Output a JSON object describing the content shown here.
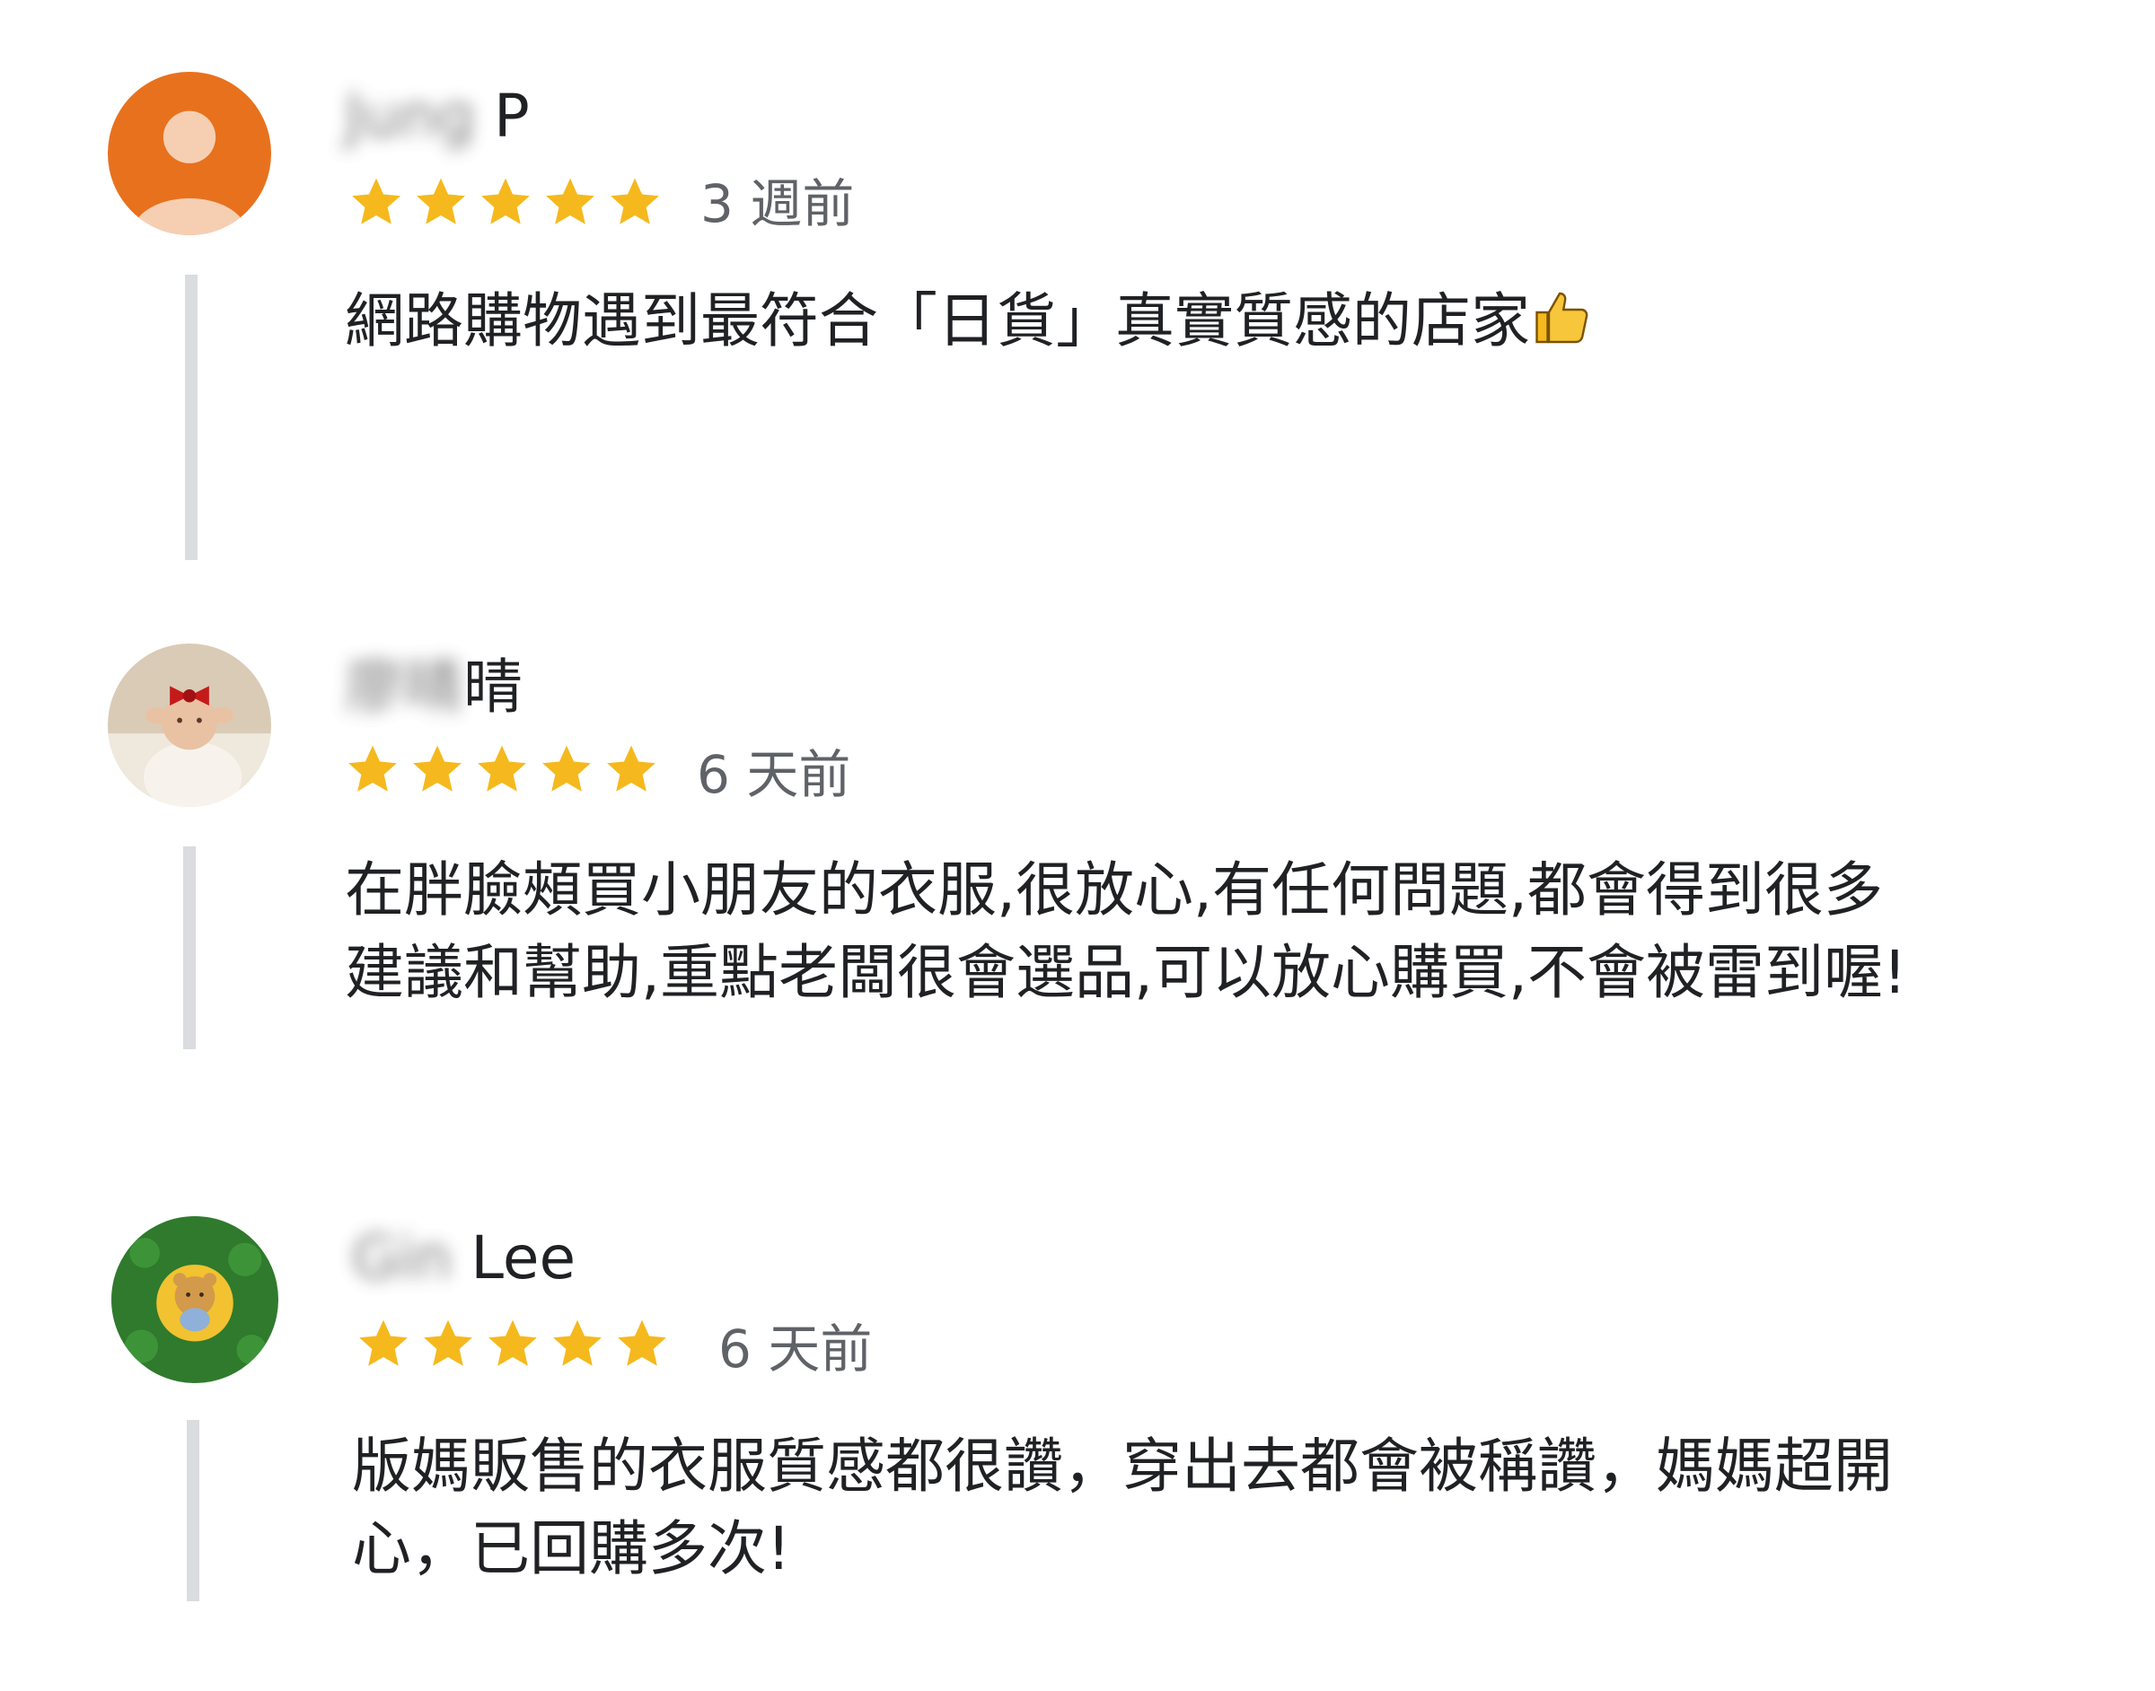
{
  "reviews": [
    {
      "name_blurred": "Jung",
      "name_visible": "P",
      "rating": 5,
      "time": "3 週前",
      "text_lines": [
        "網路購物遇到最符合「日貨」真實質感的店家"
      ],
      "emoji_icon": "thumbs-up-icon",
      "avatar": "default-person-avatar",
      "avatar_color": "#e8711e"
    },
    {
      "name_blurred": "廖晴",
      "name_visible": "晴",
      "rating": 5,
      "time": "6 天前",
      "text_lines": [
        "在胖臉頰買小朋友的衣服,很放心,有任何問題,都會得到很多",
        "建議和幫助,重點老闆很會選品,可以放心購買,不會被雷到喔!"
      ],
      "avatar": "baby-photo-avatar"
    },
    {
      "name_blurred": "Gin",
      "name_visible": "Lee",
      "rating": 5,
      "time": "6 天前",
      "text_lines": [
        "版媽販售的衣服質感都很讚，穿出去都會被稱讚，媽媽超開",
        "心，已回購多次!"
      ],
      "avatar": "bear-toy-avatar"
    }
  ],
  "colors": {
    "star": "#f5b91e",
    "rail": "#dadce0",
    "meta_text": "#5f6368"
  }
}
